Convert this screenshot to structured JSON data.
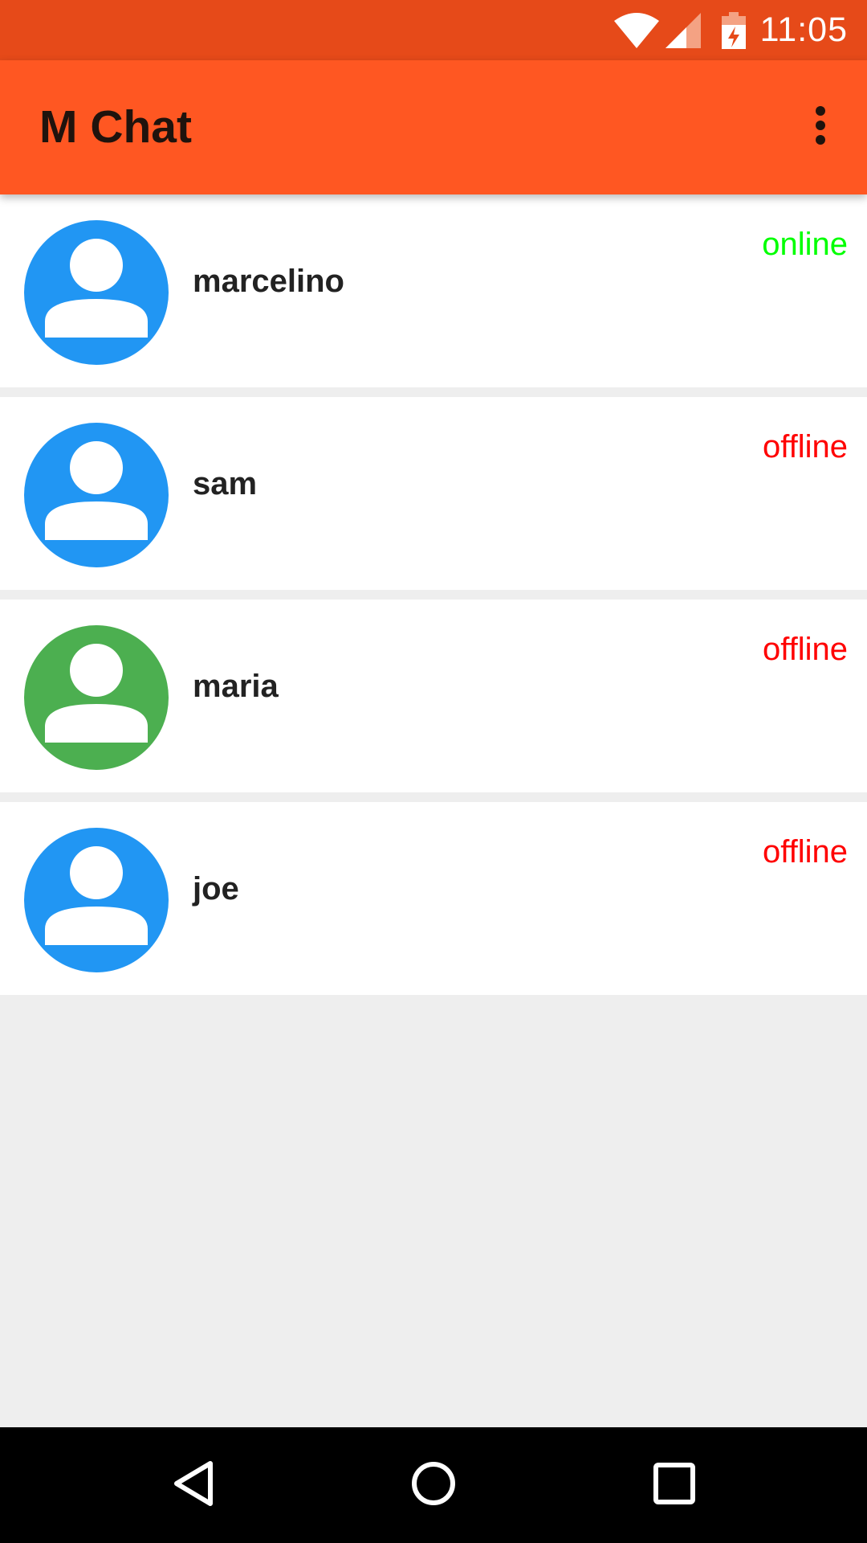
{
  "status_bar": {
    "time": "11:05",
    "icons": [
      "wifi-icon",
      "cell-signal-icon",
      "battery-charging-icon"
    ],
    "background_color": "#e64a19"
  },
  "app_bar": {
    "title": "M Chat",
    "menu_icon": "more-vert-icon",
    "background_color": "#ff5722"
  },
  "contacts": [
    {
      "name": "marcelino",
      "status": "online",
      "status_color": "#00ff00",
      "avatar_color": "#2196f3",
      "avatar_icon": "person-icon"
    },
    {
      "name": "sam",
      "status": "offline",
      "status_color": "#ff0000",
      "avatar_color": "#2196f3",
      "avatar_icon": "person-icon"
    },
    {
      "name": "maria",
      "status": "offline",
      "status_color": "#ff0000",
      "avatar_color": "#4caf50",
      "avatar_icon": "person-icon"
    },
    {
      "name": "joe",
      "status": "offline",
      "status_color": "#ff0000",
      "avatar_color": "#2196f3",
      "avatar_icon": "person-icon"
    }
  ],
  "nav_bar": {
    "buttons": [
      "back-icon",
      "home-icon",
      "recents-icon"
    ]
  }
}
